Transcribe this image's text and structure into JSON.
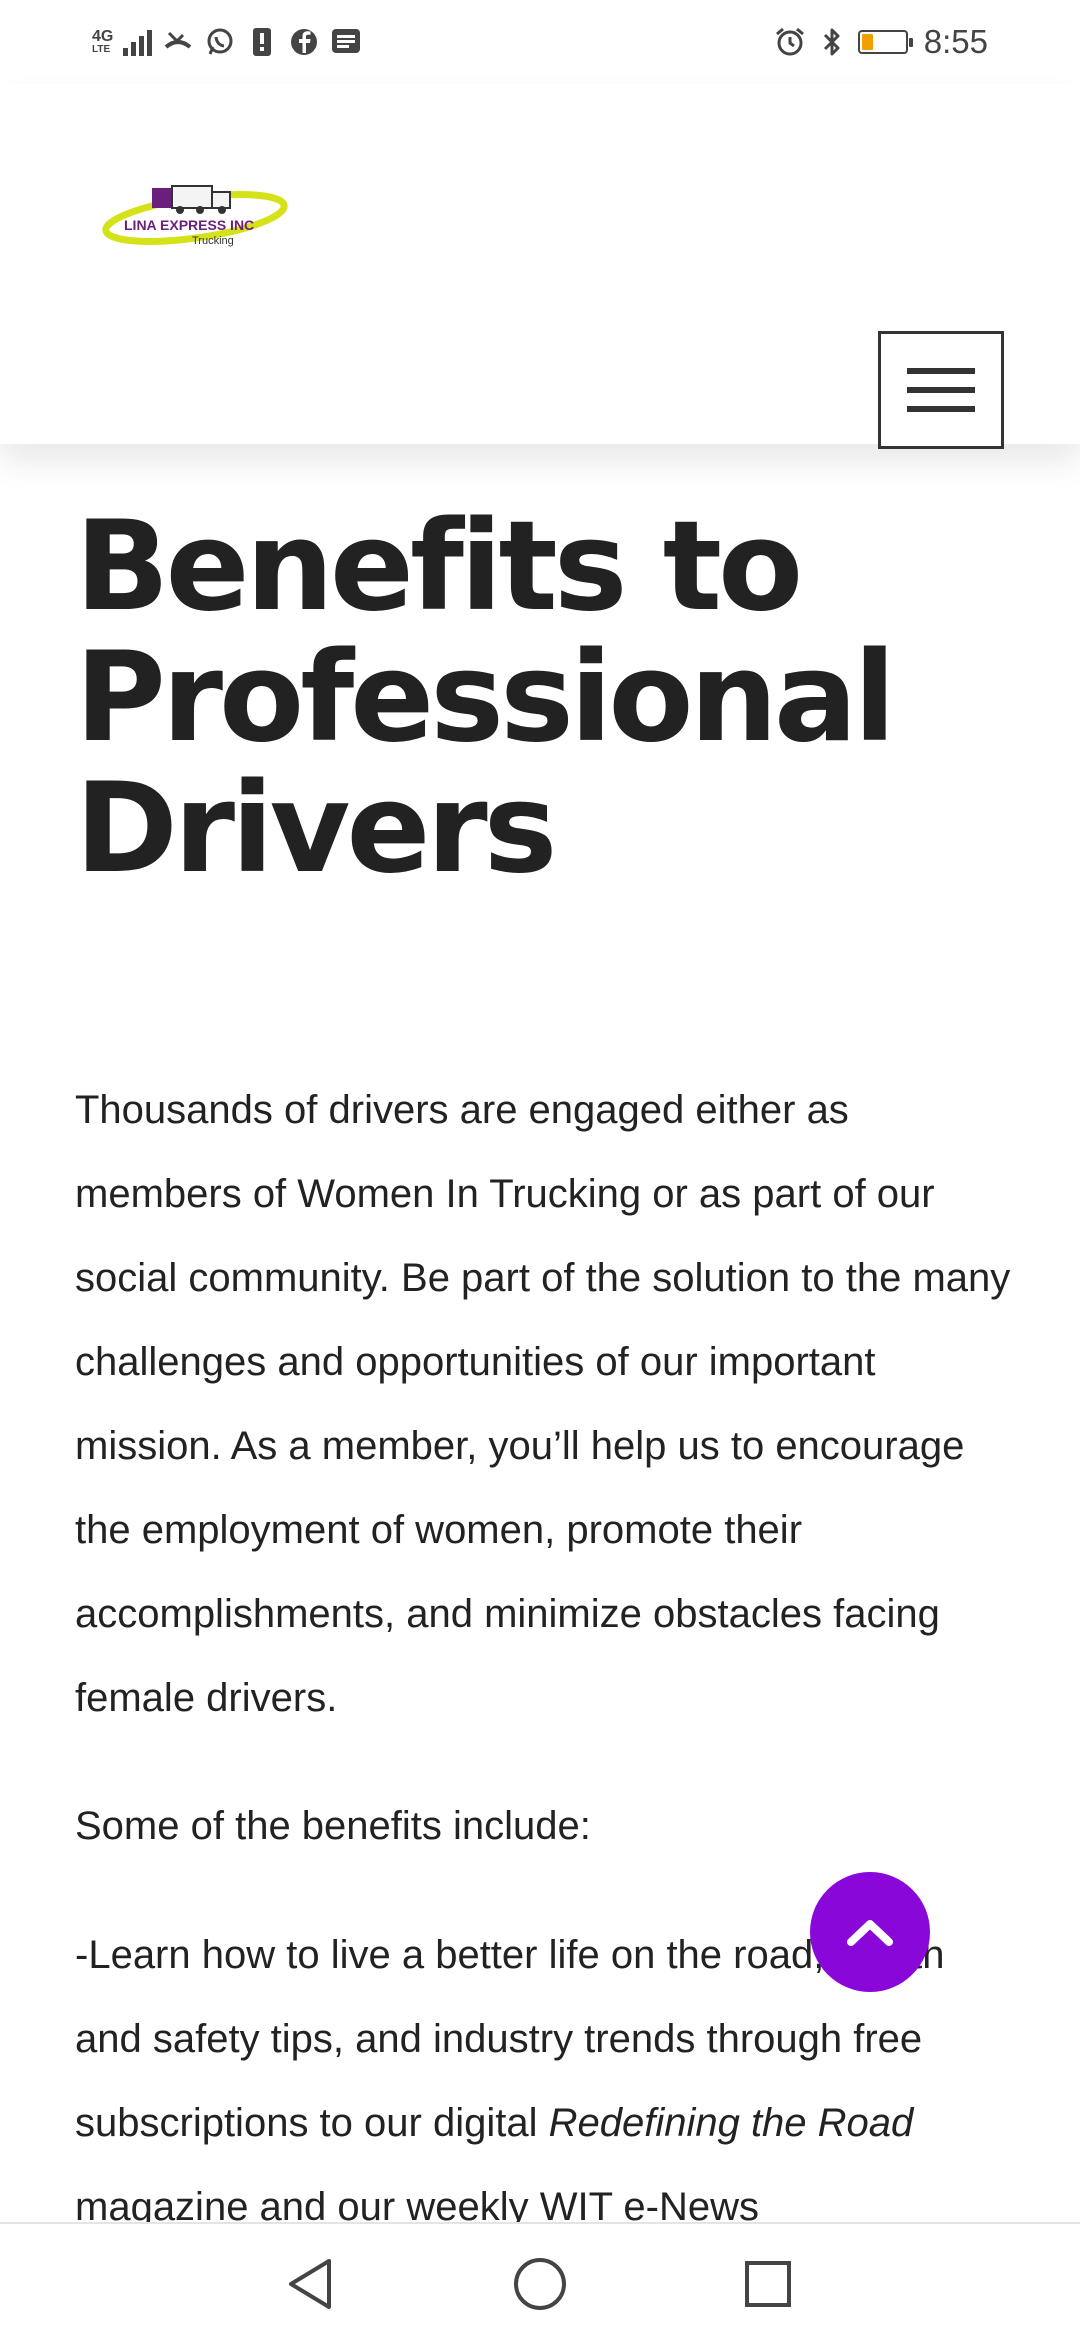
{
  "status_bar": {
    "network": "4G",
    "network_sub": "LTE",
    "time": "8:55",
    "icons_left": [
      "signal-icon",
      "missed-call-icon",
      "whatsapp-icon",
      "notification-alert-icon",
      "facebook-icon",
      "message-icon"
    ],
    "icons_right": [
      "alarm-icon",
      "bluetooth-icon",
      "battery-icon"
    ],
    "battery_level": 0.25
  },
  "header": {
    "logo_name": "LINA EXPRESS INC",
    "logo_sub": "Trucking",
    "menu_icon": "hamburger-menu-icon"
  },
  "page": {
    "title": "Benefits to Professional Drivers",
    "paragraph1": "Thousands of drivers are engaged either as members of Women In Trucking or as part of our social community. Be part of the solution to the many challenges and opportunities of our important mission. As a member, you’ll help us to encourage the employment of women, promote their accomplishments, and minimize obstacles facing female drivers.",
    "paragraph2": "Some of the benefits include:",
    "paragraph3_a": "-Learn how to live a better life on the road, health and safety tips, and industry trends through free subscriptions to our digital ",
    "paragraph3_em": "Redefining the Road",
    "paragraph3_b": " magazine and our weekly WIT e-News"
  },
  "fab": {
    "icon": "chevron-up-icon"
  },
  "nav_bar": {
    "icons": [
      "back-icon",
      "home-icon",
      "recents-icon"
    ]
  },
  "colors": {
    "accent": "#8a07d9",
    "text": "#222222",
    "logo_purple": "#6b1f7c",
    "logo_yellow": "#d5e21a",
    "battery": "#f2a000"
  }
}
